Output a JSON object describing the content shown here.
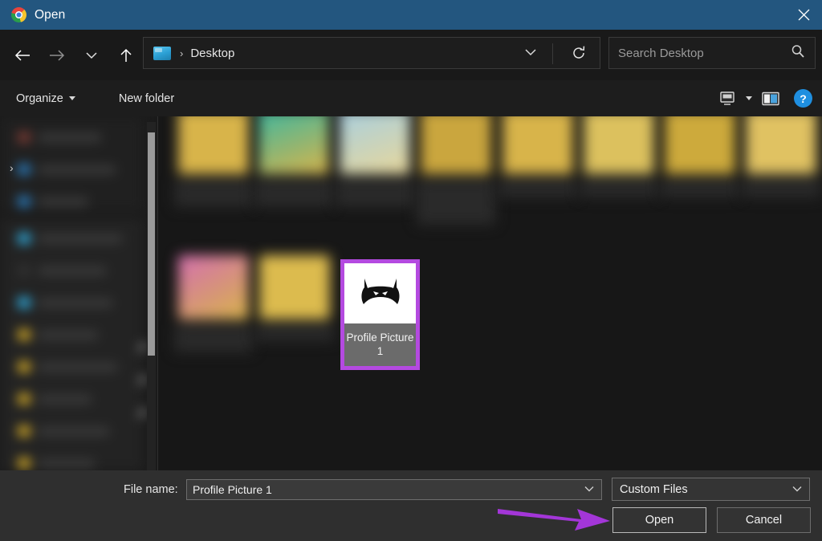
{
  "window": {
    "title": "Open",
    "app_icon": "chrome-logo-icon",
    "close_icon": "close-icon",
    "titlebar_color": "#23567f"
  },
  "navigation": {
    "back_icon": "back-arrow-icon",
    "forward_icon": "forward-arrow-icon",
    "recent_icon": "chevron-down-icon",
    "up_icon": "up-arrow-icon",
    "address": {
      "folder_icon": "desktop-icon",
      "separator": "›",
      "crumb": "Desktop",
      "dropdown_icon": "chevron-down-icon",
      "refresh_icon": "refresh-icon"
    },
    "search": {
      "placeholder": "Search Desktop",
      "icon": "search-icon"
    }
  },
  "command_bar": {
    "organize": "Organize",
    "organize_caret": "caret-down-icon",
    "new_folder": "New folder",
    "view_icon": "view-options-icon",
    "view_caret": "caret-down-icon",
    "pane_icon": "preview-pane-icon",
    "help_label": "?",
    "help_icon": "help-icon"
  },
  "sidebar": {
    "blurred": true,
    "expand_icon": "chevron-right-icon",
    "pin_icon": "pin-icon",
    "scrollbar": "vertical-scrollbar"
  },
  "file_list": {
    "selected_item": {
      "name": "Profile Picture 1",
      "thumbnail_icon": "batman-mask-icon",
      "selection_color": "#b44ae0",
      "label_background": "#6b6b6b"
    },
    "blurred_items_row1": 8,
    "blurred_items_row2": 2
  },
  "footer": {
    "file_name_label": "File name:",
    "file_name_value": "Profile Picture 1",
    "file_name_placeholder": "File name",
    "file_name_dropdown_icon": "chevron-down-icon",
    "file_type_value": "Custom Files",
    "file_type_dropdown_icon": "chevron-down-icon",
    "open_button": "Open",
    "cancel_button": "Cancel"
  },
  "annotation": {
    "arrow_icon": "pointer-arrow-icon",
    "arrow_color": "#a336d8",
    "points_to": "Open"
  }
}
